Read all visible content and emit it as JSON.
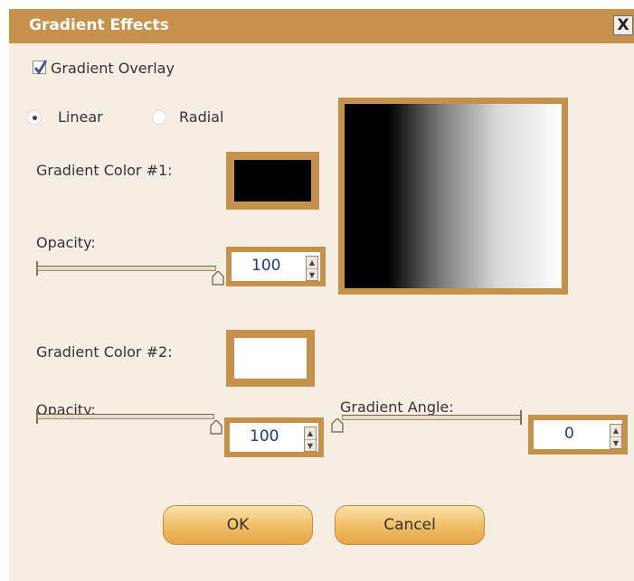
{
  "dialog": {
    "title": "Gradient Effects",
    "close_label": "X"
  },
  "overlay": {
    "label": "Gradient Overlay",
    "checked": true
  },
  "type": {
    "linear_label": "Linear",
    "radial_label": "Radial",
    "selected": "Linear"
  },
  "color1": {
    "label": "Gradient Color #1:",
    "color": "#000000"
  },
  "opacity1": {
    "label": "Opacity:",
    "value": "100",
    "level_percent": 100
  },
  "color2": {
    "label": "Gradient Color #2:",
    "color": "#ffffff"
  },
  "opacity2": {
    "label": "Opacity:",
    "value": "100",
    "level_percent": 100
  },
  "angle": {
    "label": "Gradient Angle:",
    "value": "0",
    "level_percent": 0
  },
  "buttons": {
    "ok_label": "OK",
    "cancel_label": "Cancel"
  },
  "colors": {
    "accent": "#c6914a",
    "dialog_bg": "#f7eee3",
    "button_gold": "#f1c06a"
  },
  "icons": {
    "check": "checkmark-icon",
    "spin_up": "spin-up-icon",
    "spin_down": "spin-down-icon",
    "thumb": "slider-thumb-icon"
  }
}
